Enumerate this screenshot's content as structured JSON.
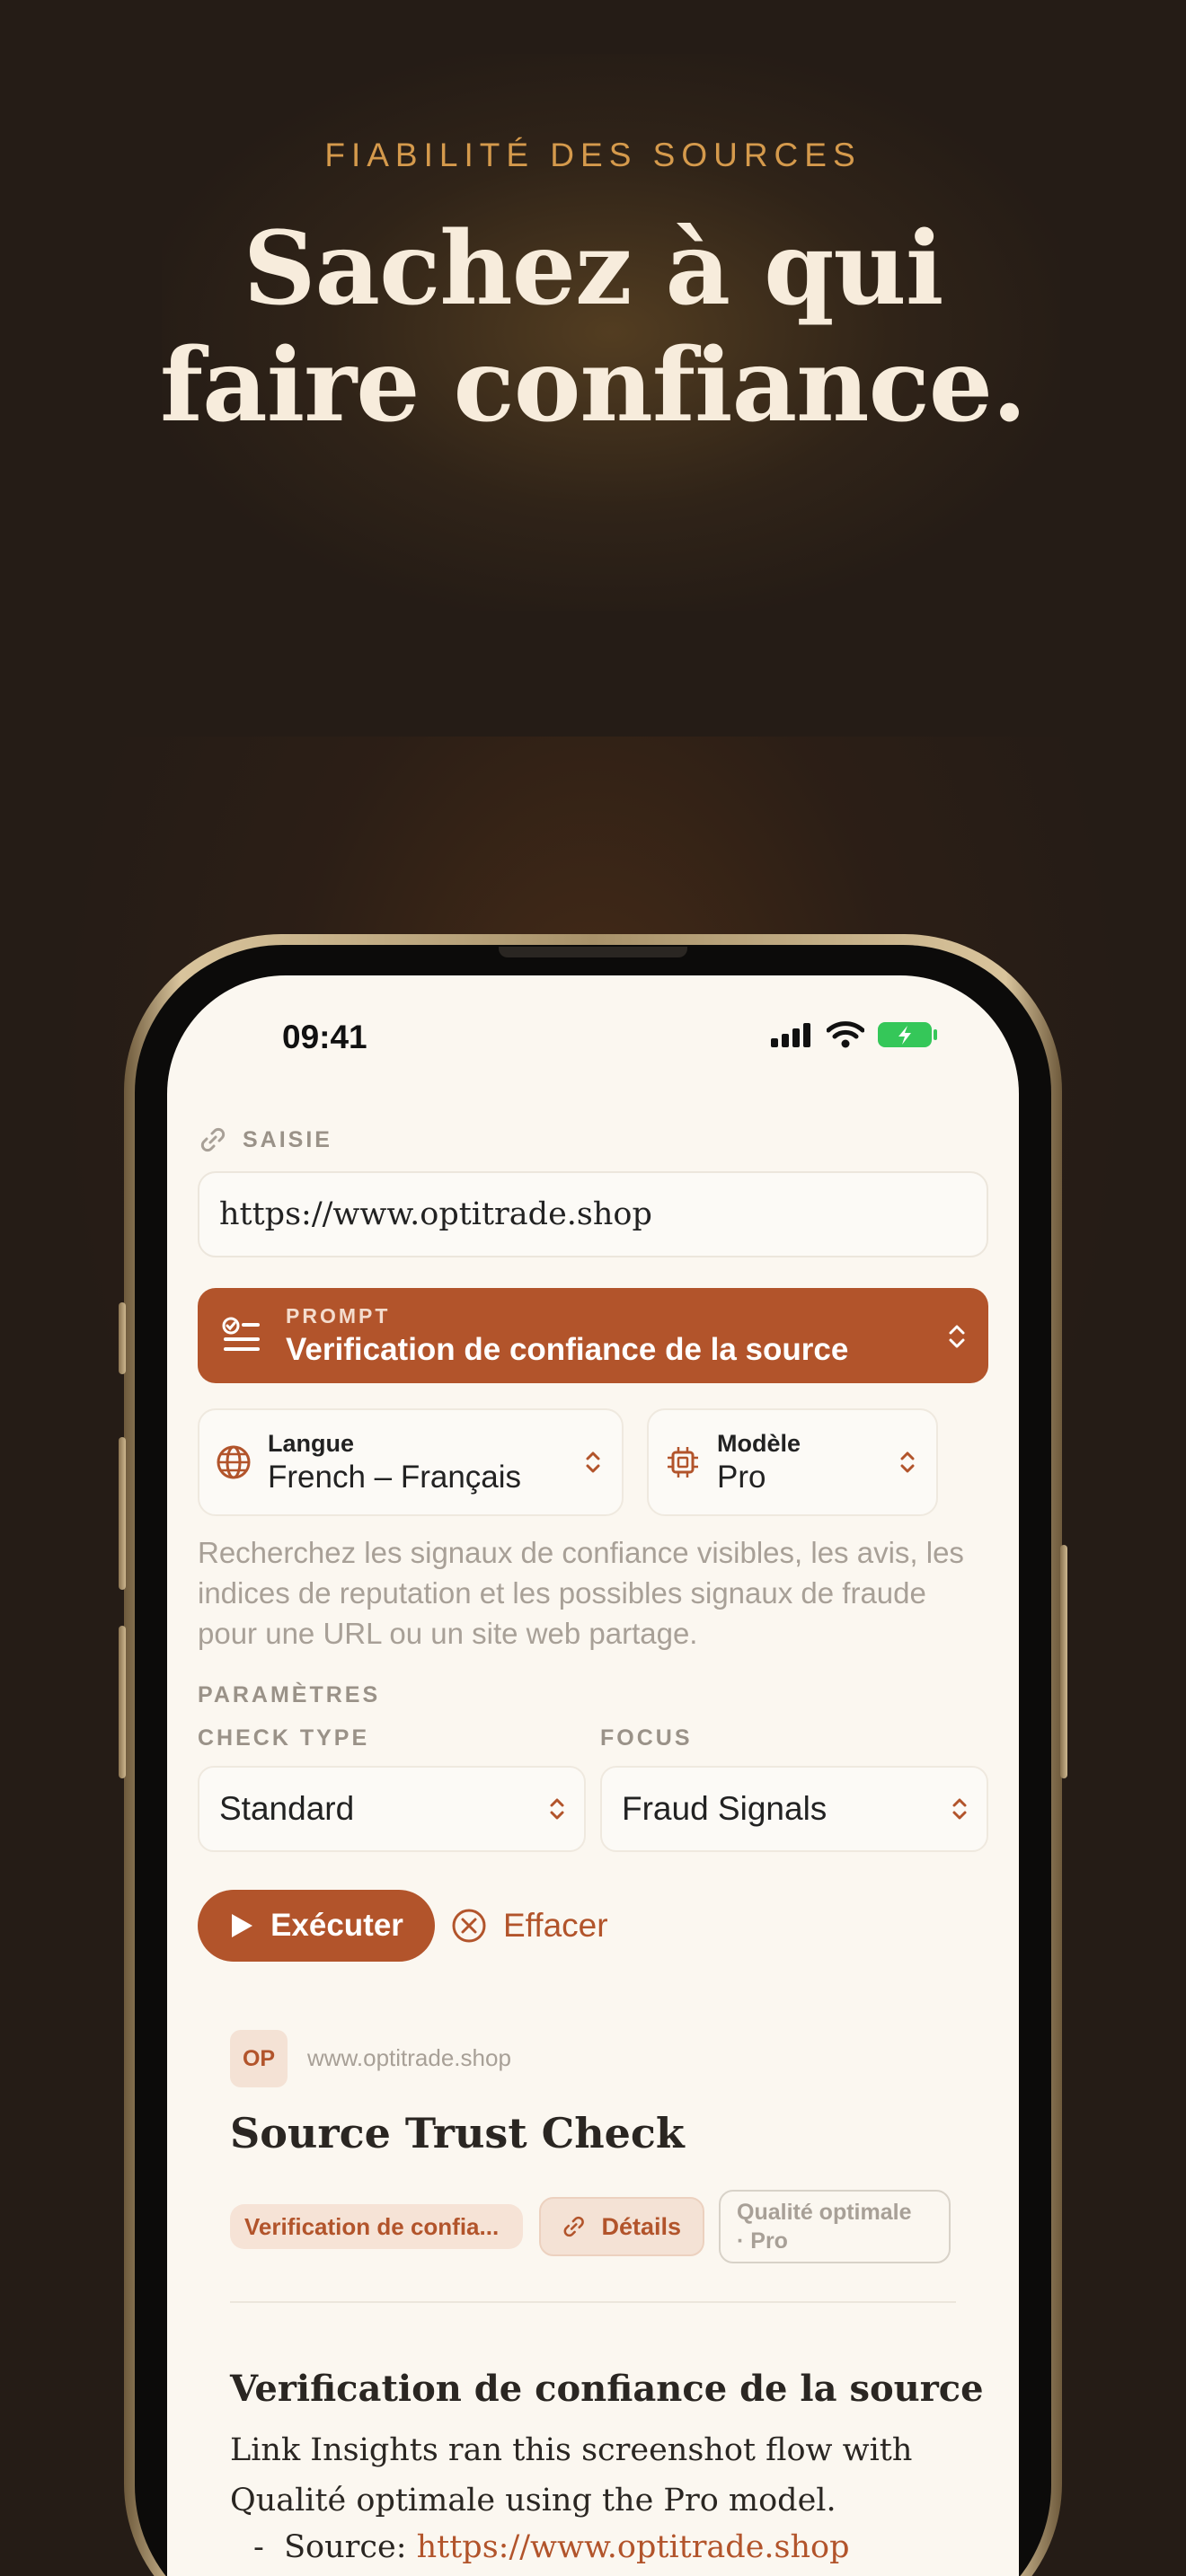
{
  "hero": {
    "eyebrow": "FIABILITÉ DES SOURCES",
    "headline_line1": "Sachez à qui",
    "headline_line2": "faire confiance."
  },
  "status_bar": {
    "time": "09:41"
  },
  "input_section": {
    "label": "SAISIE",
    "url_value": "https://www.optitrade.shop"
  },
  "prompt": {
    "kicker": "PROMPT",
    "title": "Verification de confiance de la source"
  },
  "language_picker": {
    "label": "Langue",
    "value": "French – Français"
  },
  "model_picker": {
    "label": "Modèle",
    "value": "Pro"
  },
  "description": "Recherchez les signaux de confiance visibles, les avis, les indices de reputation et les possibles signaux de fraude pour une URL ou un site web partage.",
  "parameters": {
    "label": "PARAMÈTRES",
    "check_type_label": "CHECK TYPE",
    "check_type_value": "Standard",
    "focus_label": "FOCUS",
    "focus_value": "Fraud Signals"
  },
  "actions": {
    "run_label": "Exécuter",
    "clear_label": "Effacer"
  },
  "result": {
    "avatar_initials": "OP",
    "domain": "www.optitrade.shop",
    "title": "Source Trust Check",
    "chip_prompt": "Verification de confia...",
    "chip_details": "Détails",
    "chip_quality_line1": "Qualité optimale",
    "chip_quality_line2": "· Pro",
    "section_heading": "Verification de confiance de la source",
    "body": "Link Insights ran this screenshot flow with Qualité optimale using the Pro model.",
    "bullet_prefix": "Source: ",
    "bullet_link": "https://www.optitrade.shop"
  },
  "colors": {
    "accent": "#b2542b",
    "background": "#251c16",
    "gold": "#d59a4c",
    "screen": "#fbf7f0"
  }
}
